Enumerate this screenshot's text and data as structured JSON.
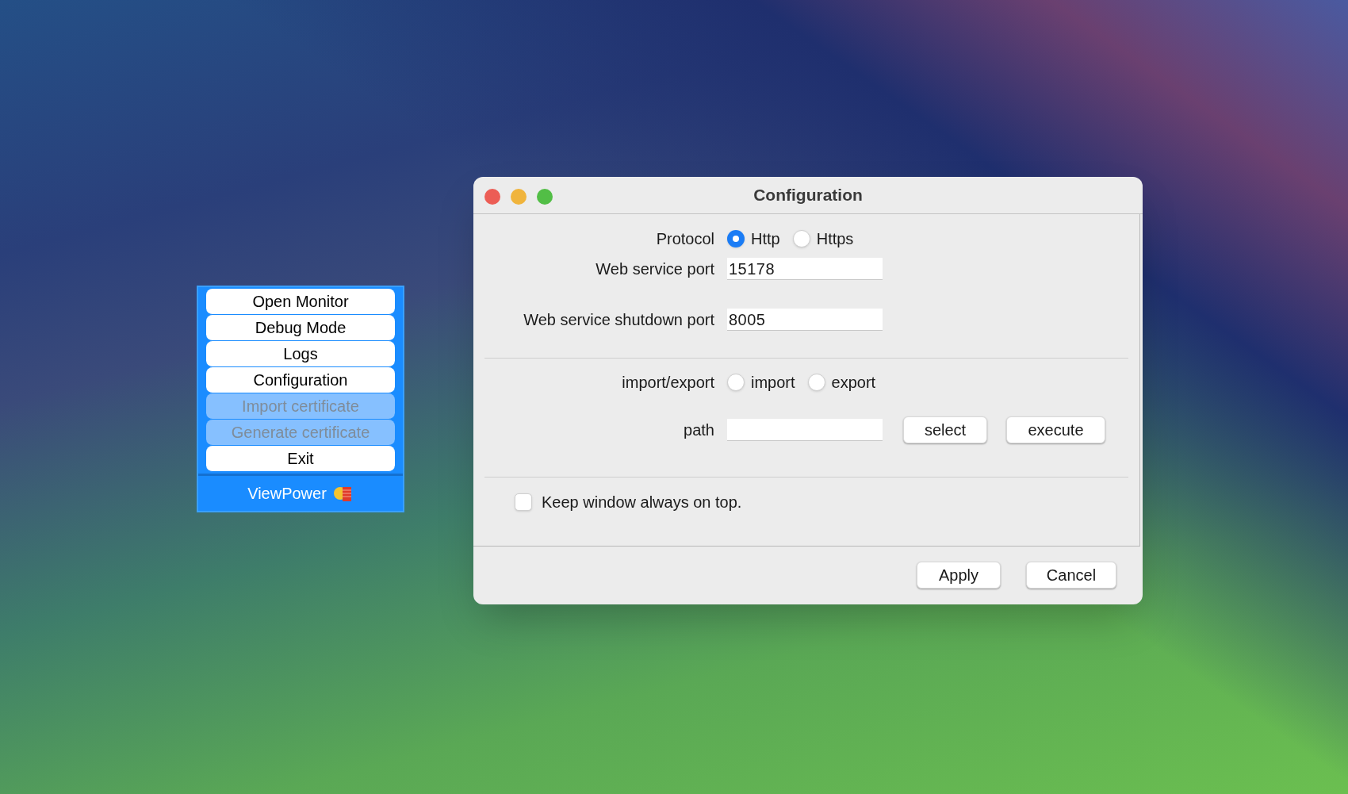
{
  "menu": {
    "items": [
      {
        "label": "Open Monitor",
        "disabled": false
      },
      {
        "label": "Debug Mode",
        "disabled": false
      },
      {
        "label": "Logs",
        "disabled": false
      },
      {
        "label": "Configuration",
        "disabled": false
      },
      {
        "label": "Import certificate",
        "disabled": true
      },
      {
        "label": "Generate certificate",
        "disabled": true
      },
      {
        "label": "Exit",
        "disabled": false
      }
    ],
    "footer": "ViewPower"
  },
  "dialog": {
    "title": "Configuration",
    "protocol": {
      "label": "Protocol",
      "options": [
        {
          "label": "Http",
          "selected": true
        },
        {
          "label": "Https",
          "selected": false
        }
      ]
    },
    "web_service_port": {
      "label": "Web service port",
      "value": "15178"
    },
    "web_service_shutdown_port": {
      "label": "Web service shutdown port",
      "value": "8005"
    },
    "import_export": {
      "label": "import/export",
      "options": [
        {
          "label": "import",
          "selected": false
        },
        {
          "label": "export",
          "selected": false
        }
      ]
    },
    "path": {
      "label": "path",
      "buttons": [
        "select",
        "execute"
      ]
    },
    "keep_on_top": {
      "label": "Keep window always on top.",
      "checked": false
    },
    "buttons": [
      "Apply",
      "Cancel"
    ]
  }
}
